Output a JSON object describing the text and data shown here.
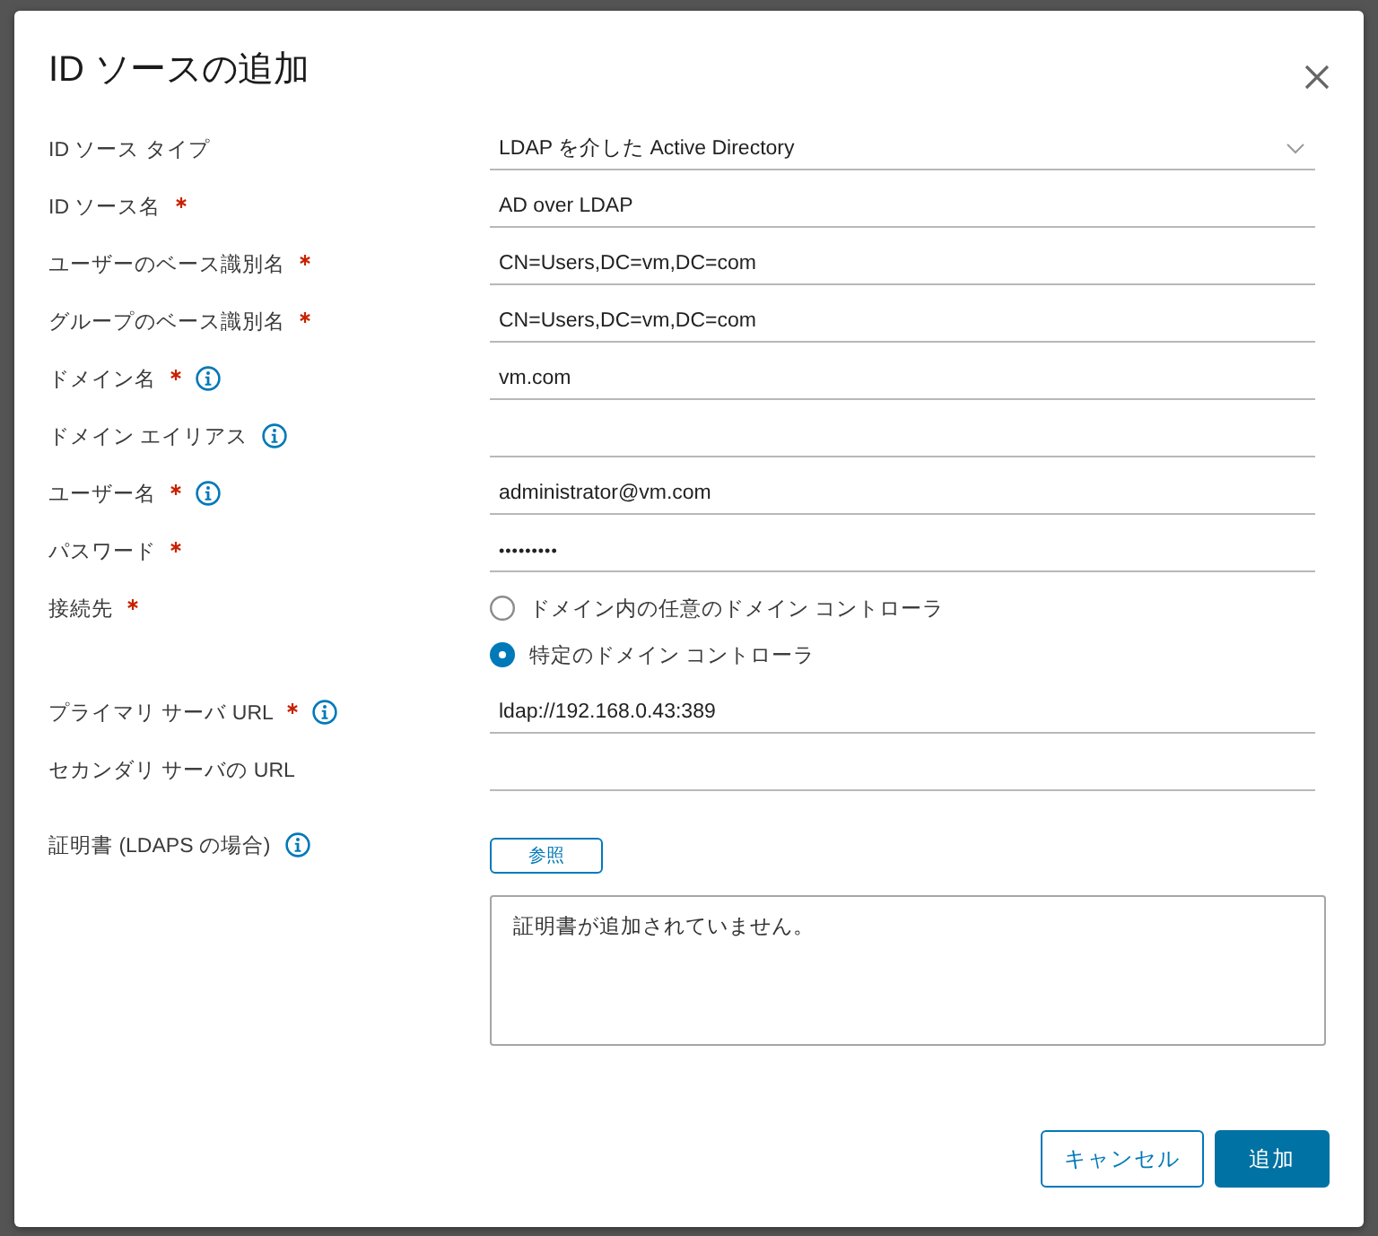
{
  "dialog": {
    "title": "ID ソースの追加"
  },
  "form": {
    "fields": [
      {
        "kind": "select",
        "label": "ID ソース タイプ",
        "required": false,
        "info": false,
        "value": "LDAP を介した Active Directory"
      },
      {
        "kind": "text",
        "label": "ID ソース名",
        "required": true,
        "info": false,
        "value": "AD over LDAP"
      },
      {
        "kind": "text",
        "label": "ユーザーのベース識別名",
        "required": true,
        "info": false,
        "value": "CN=Users,DC=vm,DC=com"
      },
      {
        "kind": "text",
        "label": "グループのベース識別名",
        "required": true,
        "info": false,
        "value": "CN=Users,DC=vm,DC=com"
      },
      {
        "kind": "text",
        "label": "ドメイン名",
        "required": true,
        "info": true,
        "value": "vm.com"
      },
      {
        "kind": "text",
        "label": "ドメイン エイリアス",
        "required": false,
        "info": true
      },
      {
        "kind": "text",
        "label": "ユーザー名",
        "required": true,
        "info": true,
        "value": "administrator@vm.com"
      },
      {
        "kind": "password",
        "label": "パスワード",
        "required": true,
        "info": false,
        "value": "•••••••••"
      },
      {
        "kind": "radio",
        "label": "接続先",
        "required": true,
        "info": false,
        "options": [
          {
            "label": "ドメイン内の任意のドメイン コントローラ",
            "selected": false
          },
          {
            "label": "特定のドメイン コントローラ",
            "selected": true
          }
        ]
      },
      {
        "kind": "text",
        "label": "プライマリ サーバ URL",
        "required": true,
        "info": true,
        "value": "ldap://192.168.0.43:389"
      },
      {
        "kind": "text",
        "label": "セカンダリ サーバの URL",
        "required": false,
        "info": false
      },
      {
        "kind": "certificate",
        "label": "証明書 (LDAPS の場合)",
        "required": false,
        "info": true,
        "button": "参照",
        "list_text": "証明書が追加されていません。"
      }
    ]
  },
  "footer": {
    "buttons": [
      {
        "label": "キャンセル",
        "kind": "secondary"
      },
      {
        "label": "追加",
        "kind": "primary"
      }
    ]
  }
}
